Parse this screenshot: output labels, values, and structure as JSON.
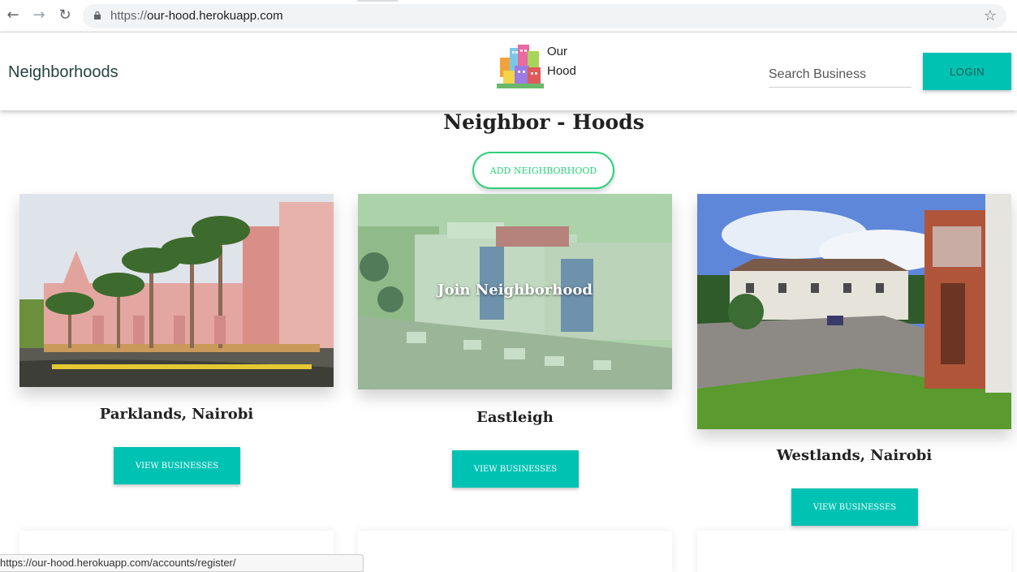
{
  "browser": {
    "url_scheme": "https://",
    "url_host": "our-hood.herokuapp.com",
    "back_icon": "arrow-left-icon",
    "forward_icon": "arrow-right-icon",
    "reload_icon": "reload-icon",
    "bookmark_icon": "star-icon"
  },
  "header": {
    "brand": "Neighborhoods",
    "logo_line1": "Our",
    "logo_line2": "Hood",
    "search_placeholder": "Search Business",
    "login_label": "LOGIN"
  },
  "main": {
    "title": "Neighbor - Hoods",
    "add_button": "ADD NEIGHBORHOOD",
    "cards": [
      {
        "name": "Parklands, Nairobi",
        "button": "VIEW BUSINESSES"
      },
      {
        "name": "Eastleigh",
        "button": "VIEW BUSINESSES",
        "hover_label": "Join Neighborhood"
      },
      {
        "name": "Westlands, Nairobi",
        "button": "VIEW BUSINESSES"
      }
    ]
  },
  "status_bar": "https://our-hood.herokuapp.com/accounts/register/",
  "colors": {
    "accent": "#00c2b3",
    "add_button": "#2bd27a",
    "brand_text": "#26443e"
  }
}
